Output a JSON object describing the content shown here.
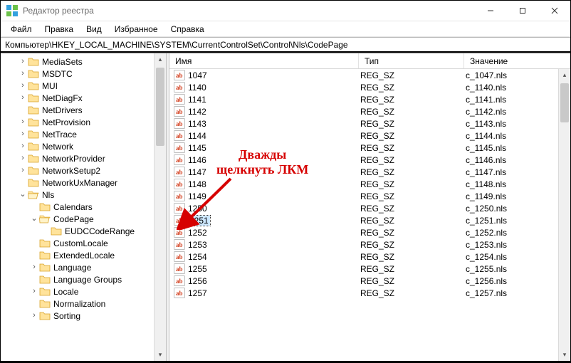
{
  "window": {
    "title": "Редактор реестра",
    "min": "—",
    "max": "▢",
    "close": "✕"
  },
  "menu": [
    "Файл",
    "Правка",
    "Вид",
    "Избранное",
    "Справка"
  ],
  "path": "Компьютер\\HKEY_LOCAL_MACHINE\\SYSTEM\\CurrentControlSet\\Control\\Nls\\CodePage",
  "tree": [
    {
      "indent": 1,
      "label": "MediaSets",
      "toggle": ">"
    },
    {
      "indent": 1,
      "label": "MSDTC",
      "toggle": ">"
    },
    {
      "indent": 1,
      "label": "MUI",
      "toggle": ">"
    },
    {
      "indent": 1,
      "label": "NetDiagFx",
      "toggle": ">"
    },
    {
      "indent": 1,
      "label": "NetDrivers",
      "toggle": ""
    },
    {
      "indent": 1,
      "label": "NetProvision",
      "toggle": ">"
    },
    {
      "indent": 1,
      "label": "NetTrace",
      "toggle": ">"
    },
    {
      "indent": 1,
      "label": "Network",
      "toggle": ">"
    },
    {
      "indent": 1,
      "label": "NetworkProvider",
      "toggle": ">"
    },
    {
      "indent": 1,
      "label": "NetworkSetup2",
      "toggle": ">"
    },
    {
      "indent": 1,
      "label": "NetworkUxManager",
      "toggle": ""
    },
    {
      "indent": 1,
      "label": "Nls",
      "toggle": "v",
      "open": true
    },
    {
      "indent": 2,
      "label": "Calendars",
      "toggle": ""
    },
    {
      "indent": 2,
      "label": "CodePage",
      "toggle": "v",
      "open": true
    },
    {
      "indent": 3,
      "label": "EUDCCodeRange",
      "toggle": ""
    },
    {
      "indent": 2,
      "label": "CustomLocale",
      "toggle": ""
    },
    {
      "indent": 2,
      "label": "ExtendedLocale",
      "toggle": ""
    },
    {
      "indent": 2,
      "label": "Language",
      "toggle": ">"
    },
    {
      "indent": 2,
      "label": "Language Groups",
      "toggle": ""
    },
    {
      "indent": 2,
      "label": "Locale",
      "toggle": ">"
    },
    {
      "indent": 2,
      "label": "Normalization",
      "toggle": ""
    },
    {
      "indent": 2,
      "label": "Sorting",
      "toggle": ">"
    }
  ],
  "columns": {
    "name": "Имя",
    "type": "Тип",
    "value": "Значение"
  },
  "rows": [
    {
      "name": "1047",
      "type": "REG_SZ",
      "value": "c_1047.nls"
    },
    {
      "name": "1140",
      "type": "REG_SZ",
      "value": "c_1140.nls"
    },
    {
      "name": "1141",
      "type": "REG_SZ",
      "value": "c_1141.nls"
    },
    {
      "name": "1142",
      "type": "REG_SZ",
      "value": "c_1142.nls"
    },
    {
      "name": "1143",
      "type": "REG_SZ",
      "value": "c_1143.nls"
    },
    {
      "name": "1144",
      "type": "REG_SZ",
      "value": "c_1144.nls"
    },
    {
      "name": "1145",
      "type": "REG_SZ",
      "value": "c_1145.nls"
    },
    {
      "name": "1146",
      "type": "REG_SZ",
      "value": "c_1146.nls"
    },
    {
      "name": "1147",
      "type": "REG_SZ",
      "value": "c_1147.nls"
    },
    {
      "name": "1148",
      "type": "REG_SZ",
      "value": "c_1148.nls"
    },
    {
      "name": "1149",
      "type": "REG_SZ",
      "value": "c_1149.nls"
    },
    {
      "name": "1250",
      "type": "REG_SZ",
      "value": "c_1250.nls"
    },
    {
      "name": "1251",
      "type": "REG_SZ",
      "value": "c_1251.nls",
      "selected": true
    },
    {
      "name": "1252",
      "type": "REG_SZ",
      "value": "c_1252.nls"
    },
    {
      "name": "1253",
      "type": "REG_SZ",
      "value": "c_1253.nls"
    },
    {
      "name": "1254",
      "type": "REG_SZ",
      "value": "c_1254.nls"
    },
    {
      "name": "1255",
      "type": "REG_SZ",
      "value": "c_1255.nls"
    },
    {
      "name": "1256",
      "type": "REG_SZ",
      "value": "c_1256.nls"
    },
    {
      "name": "1257",
      "type": "REG_SZ",
      "value": "c_1257.nls"
    }
  ],
  "annotation": {
    "line1": "Дважды",
    "line2": "щелкнуть ЛКМ"
  }
}
